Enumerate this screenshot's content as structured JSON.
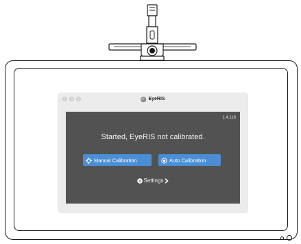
{
  "window": {
    "title": "EyeRIS"
  },
  "app": {
    "version": "1.4.118",
    "status_text": "Started, EyeRIS not calibrated.",
    "buttons": {
      "manual_calibration": "Manual Calibration",
      "auto_calibration": "Auto Calibration"
    },
    "settings_label": "Settings"
  },
  "colors": {
    "button_blue": "#4a8fd6",
    "content_bg": "#525252",
    "window_bg": "#ececec"
  },
  "icons": {
    "manual": "crosshair-icon",
    "auto": "target-icon",
    "settings": "gear-icon",
    "chevron": "chevron-right-icon"
  }
}
